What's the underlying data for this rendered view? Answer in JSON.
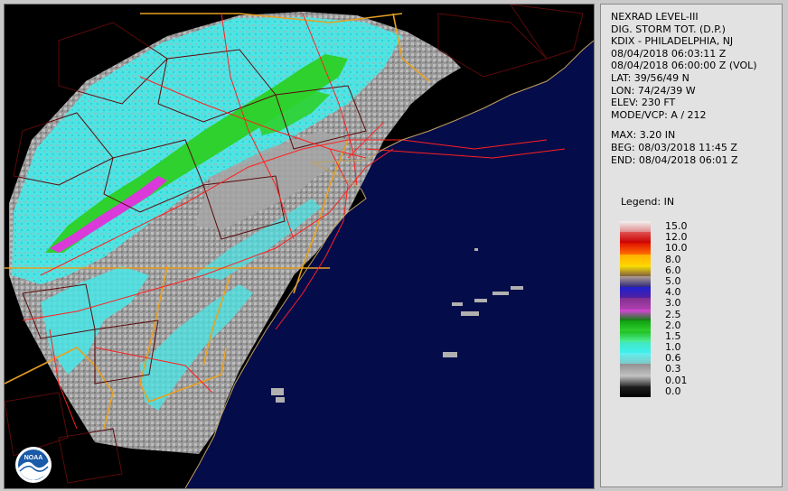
{
  "product": {
    "title": "NEXRAD LEVEL-III",
    "product_name": "DIG. STORM TOT. (D.P.)",
    "station": "KDIX - PHILADELPHIA, NJ",
    "scan_time": "08/04/2018 06:03:11 Z",
    "volume_time": "08/04/2018 06:00:00 Z (VOL)",
    "lat": "LAT: 39/56/49 N",
    "lon": "LON: 74/24/39 W",
    "elev": "ELEV: 230 FT",
    "mode": "MODE/VCP: A / 212"
  },
  "stats": {
    "max": "MAX: 3.20 IN",
    "begin": "BEG: 08/03/2018 11:45 Z",
    "end": "END: 08/04/2018 06:01 Z"
  },
  "legend": {
    "title": "Legend: IN",
    "entries": [
      {
        "label": "15.0",
        "top": "#f2f2f2",
        "bottom": "#e08a8a"
      },
      {
        "label": "12.0",
        "top": "#e05050",
        "bottom": "#c80000"
      },
      {
        "label": "10.0",
        "top": "#e01000",
        "bottom": "#ff7000"
      },
      {
        "label": "8.0",
        "top": "#ffb000",
        "bottom": "#ffd400"
      },
      {
        "label": "6.0",
        "top": "#ffe600",
        "bottom": "#806040"
      },
      {
        "label": "5.0",
        "top": "#b0a090",
        "bottom": "#302880"
      },
      {
        "label": "4.0",
        "top": "#2020d0",
        "bottom": "#5020a0"
      },
      {
        "label": "3.0",
        "top": "#803090",
        "bottom": "#b040b0"
      },
      {
        "label": "2.5",
        "top": "#e040e0",
        "bottom": "#108010"
      },
      {
        "label": "2.0",
        "top": "#10a010",
        "bottom": "#30d030"
      },
      {
        "label": "1.5",
        "top": "#20c020",
        "bottom": "#50f0a0"
      },
      {
        "label": "1.0",
        "top": "#40e8c0",
        "bottom": "#40f0f0"
      },
      {
        "label": "0.6",
        "top": "#60f0f0",
        "bottom": "#80c8c8"
      },
      {
        "label": "0.3",
        "top": "#909090",
        "bottom": "#c0c0c0"
      },
      {
        "label": "0.01",
        "top": "#c8c8c8",
        "bottom": "#303030"
      },
      {
        "label": "0.0",
        "top": "#202020",
        "bottom": "#000000"
      }
    ]
  },
  "logo": {
    "text": "NOAA"
  },
  "colors": {
    "ocean": "#050c4a",
    "land": "#000000",
    "precip_light": "#49e6e6",
    "precip_trace": "#a6a6a6",
    "precip_moderate": "#2ed12e",
    "precip_heavy": "#d93ad9",
    "county_lines": "#5a0a0a",
    "state_lines": "#e8a020",
    "roads": "#ff2020"
  }
}
